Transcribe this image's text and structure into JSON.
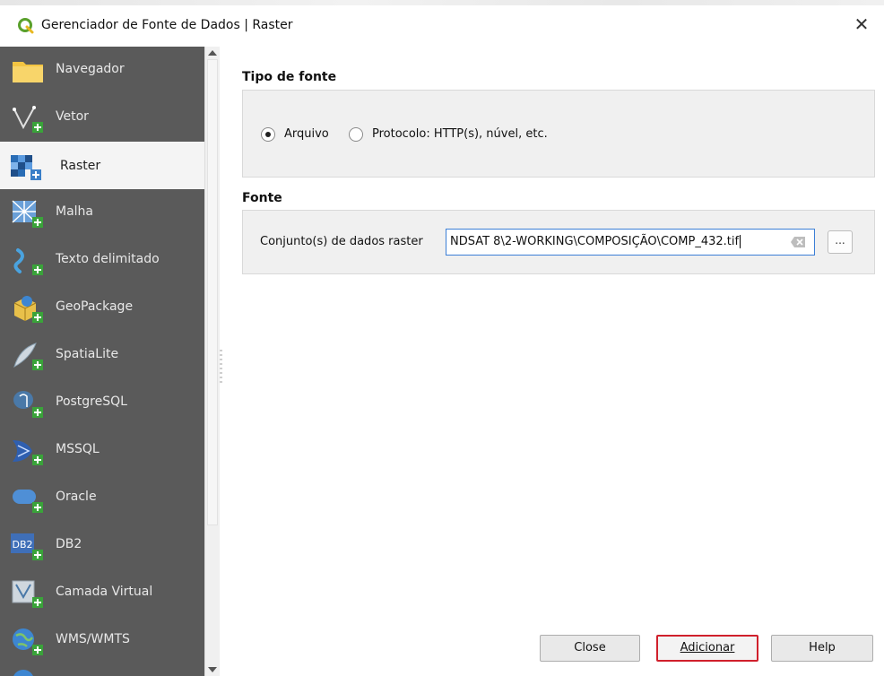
{
  "window": {
    "title": "Gerenciador de Fonte de Dados | Raster",
    "close_glyph": "✕",
    "app_icon": "qgis-icon"
  },
  "sidebar": {
    "items": [
      {
        "label": "Navegador",
        "icon": "folder-icon"
      },
      {
        "label": "Vetor",
        "icon": "vector-icon"
      },
      {
        "label": "Raster",
        "icon": "raster-icon",
        "selected": true
      },
      {
        "label": "Malha",
        "icon": "mesh-icon"
      },
      {
        "label": "Texto delimitado",
        "icon": "delimited-text-icon"
      },
      {
        "label": "GeoPackage",
        "icon": "geopackage-icon"
      },
      {
        "label": "SpatiaLite",
        "icon": "spatialite-icon"
      },
      {
        "label": "PostgreSQL",
        "icon": "postgresql-icon"
      },
      {
        "label": "MSSQL",
        "icon": "mssql-icon"
      },
      {
        "label": "Oracle",
        "icon": "oracle-icon"
      },
      {
        "label": "DB2",
        "icon": "db2-icon"
      },
      {
        "label": "Camada Virtual",
        "icon": "virtual-layer-icon"
      },
      {
        "label": "WMS/WMTS",
        "icon": "wms-icon"
      }
    ]
  },
  "source_type": {
    "title": "Tipo de fonte",
    "options": [
      {
        "label": "Arquivo",
        "checked": true
      },
      {
        "label": "Protocolo: HTTP(s), núvel, etc.",
        "checked": false
      }
    ]
  },
  "source": {
    "title": "Fonte",
    "field_label": "Conjunto(s) de dados raster",
    "path_value": "NDSAT 8\\2-WORKING\\COMPOSIÇÃO\\COMP_432.tif",
    "browse_label": "..."
  },
  "buttons": {
    "close": "Close",
    "add": "Adicionar",
    "help": "Help"
  },
  "colors": {
    "sidebar_bg": "#5a5a5a",
    "selected_bg": "#f4f4f4",
    "focus_border": "#3c7fd6",
    "highlight_border": "#d0202c"
  }
}
